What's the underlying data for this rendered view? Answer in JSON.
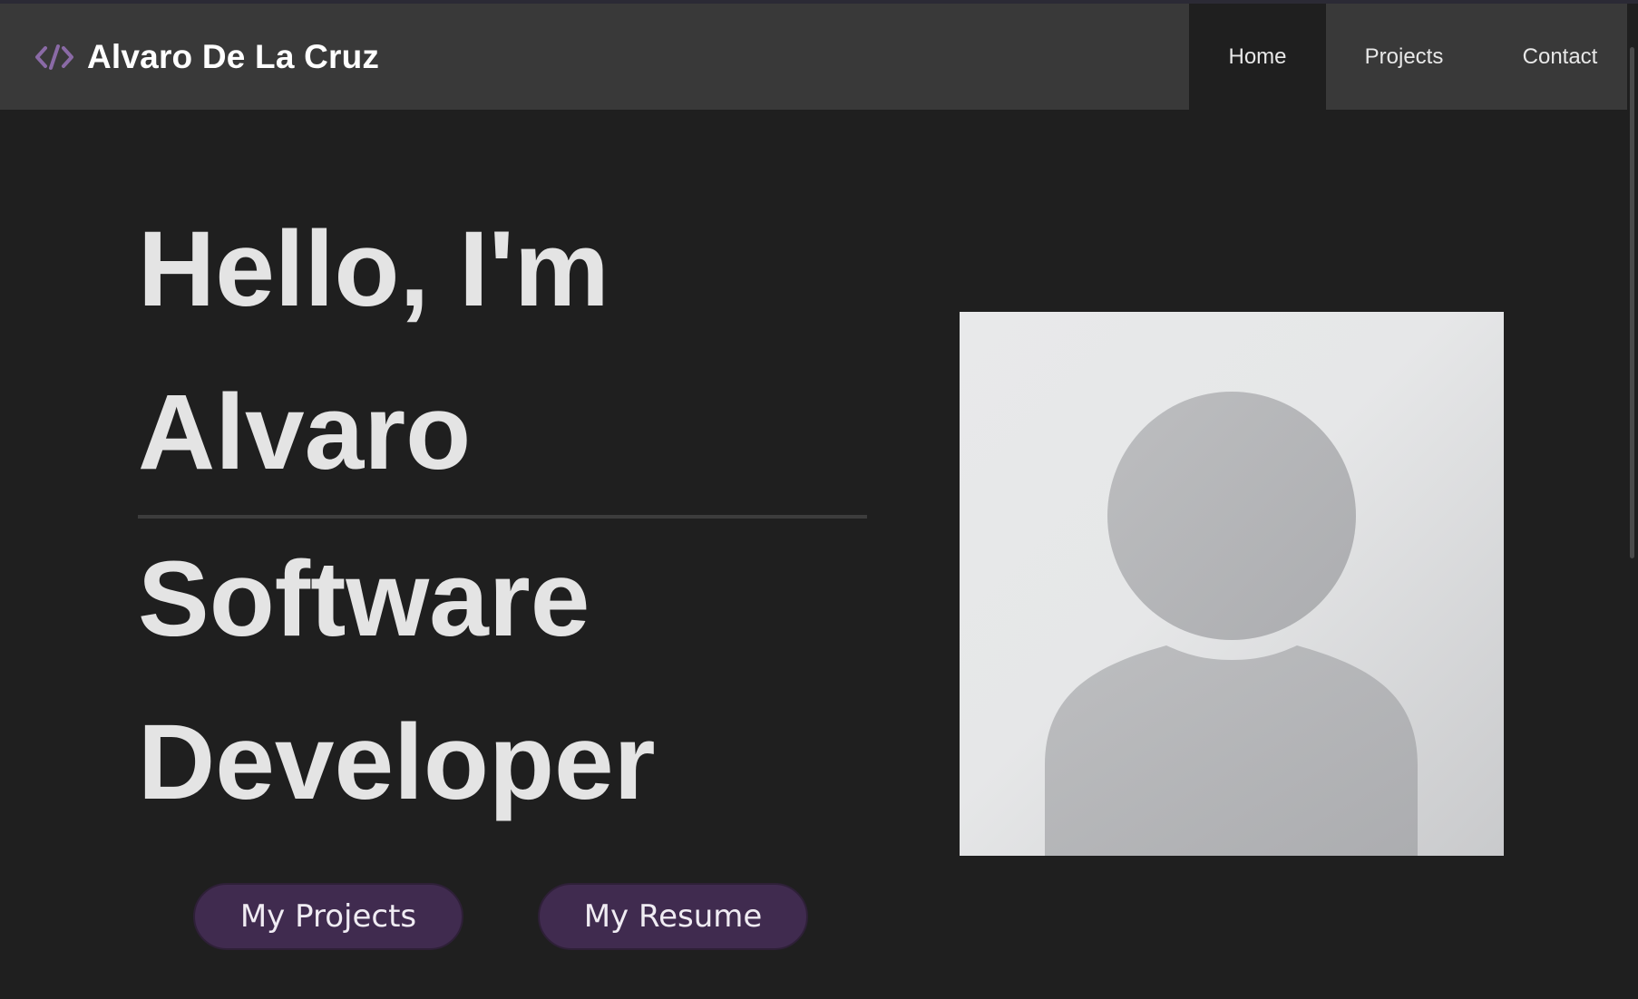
{
  "header": {
    "brand_name": "Alvaro De La Cruz",
    "brand_icon": "code-icon",
    "accent_color": "#8a6aa6"
  },
  "nav": {
    "items": [
      {
        "label": "Home",
        "active": true
      },
      {
        "label": "Projects",
        "active": false
      },
      {
        "label": "Contact",
        "active": false
      }
    ]
  },
  "hero": {
    "line1": "Hello, I'm",
    "line2": "Alvaro",
    "line3": "Software",
    "line4": "Developer",
    "projects_button": "My Projects",
    "resume_button": "My Resume",
    "button_color": "#402b4f"
  },
  "avatar": {
    "icon": "user-placeholder-icon"
  }
}
